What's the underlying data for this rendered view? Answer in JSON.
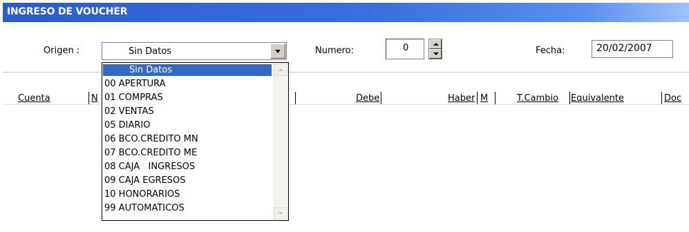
{
  "window": {
    "title": "INGRESO DE VOUCHER"
  },
  "form": {
    "origen_label": "Origen :",
    "origen_value": "Sin Datos",
    "numero_label": "Numero:",
    "numero_value": "0",
    "fecha_label": "Fecha:",
    "fecha_value": "20/02/2007"
  },
  "dropdown": {
    "items": [
      "Sin Datos",
      "00 APERTURA",
      "01 COMPRAS",
      "02 VENTAS",
      "05 DIARIO",
      "06 BCO.CREDITO MN",
      "07 BCO.CREDITO ME",
      "08 CAJA   INGRESOS",
      "09 CAJA EGRESOS",
      "10 HONORARIOS",
      "99 AUTOMATICOS"
    ],
    "selected_index": 0
  },
  "table": {
    "columns": [
      "Cuenta",
      "N",
      "Debe",
      "Haber",
      "M",
      "T.Cambio",
      "Equivalente",
      "Doc"
    ]
  },
  "colors": {
    "titlebar": "#2a5bd3",
    "selection": "#316ac5"
  }
}
